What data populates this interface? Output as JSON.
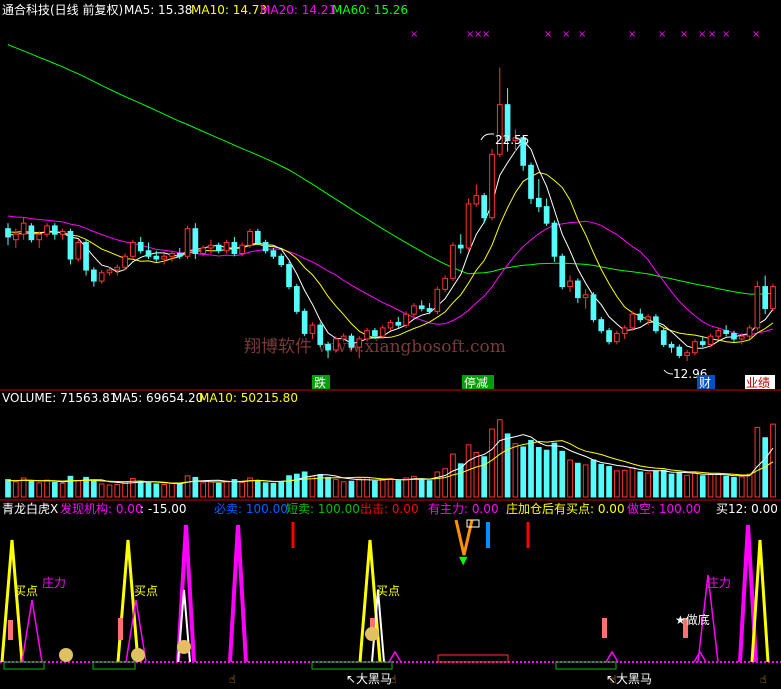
{
  "colors": {
    "background": "#000000",
    "candle_up": "#ff3232",
    "candle_down": "#54fcfc",
    "ma5": "#ffffff",
    "ma10": "#ffff00",
    "ma20": "#ff00ff",
    "ma60": "#00ff00",
    "divider": "#c80000",
    "text_default": "#ffffff",
    "label_green": "#00c000",
    "label_red": "#ff0000",
    "label_magenta": "#ff00ff",
    "label_yellow": "#ffff00"
  },
  "header": {
    "title": "通合科技(日线 前复权)",
    "ma5": "MA5: 15.38",
    "ma10": "MA10: 14.73",
    "ma20": "MA20: 14.21",
    "ma60": "MA60: 15.26"
  },
  "watermark": "翔博软件 www.xiangbosoft.com",
  "price_panel": {
    "high_label": "22.55",
    "low_label": "12.96",
    "markers": [
      {
        "text": "跌",
        "bg": "#00a000",
        "fg": "#ffffff"
      },
      {
        "text": "停减",
        "bg": "#00a000",
        "fg": "#ffffff"
      },
      {
        "text": "财",
        "bg": "#0050c0",
        "fg": "#ffffff"
      },
      {
        "text": "业绩",
        "bg": "#ffffff",
        "fg": "#c00000"
      }
    ]
  },
  "volume_panel": {
    "title": "VOLUME: 71563.81",
    "ma5": "MA5: 69654.20",
    "ma10": "MA10: 50215.80"
  },
  "indicator_panel": {
    "title": "青龙白虎X",
    "labels": [
      {
        "text": "发现机构: 0.00",
        "color": "#ff00ff"
      },
      {
        "text": ": -15.00",
        "color": "#ffffff"
      },
      {
        "text": "必卖: 100.00",
        "color": "#0060ff"
      },
      {
        "text": "短卖: 100.00",
        "color": "#00c000"
      },
      {
        "text": "出击: 0.00",
        "color": "#ff0000"
      },
      {
        "text": "有主力: 0.00",
        "color": "#ff00ff"
      },
      {
        "text": "庄加仓后有买点: 0.00",
        "color": "#ffff00"
      },
      {
        "text": "做空: 100.00",
        "color": "#ff00ff"
      },
      {
        "text": "买12: 0.00",
        "color": "#ffffff"
      }
    ],
    "annotations": [
      {
        "text": "买点",
        "color": "#ffff00"
      },
      {
        "text": "庄力",
        "color": "#ff00ff"
      },
      {
        "text": "买点",
        "color": "#ffff00"
      },
      {
        "text": "买点",
        "color": "#ffff00"
      },
      {
        "text": "庄力",
        "color": "#ff00ff"
      },
      {
        "text": "★做底",
        "color": "#ffffff"
      },
      {
        "text": "↖大黑马",
        "color": "#ffffff"
      },
      {
        "text": "↖大黑马",
        "color": "#ffffff"
      }
    ]
  },
  "chart_data": {
    "type": "candlestick",
    "price_range": [
      11.5,
      24.2
    ],
    "candles": [
      [
        16.7,
        16.9,
        16.1,
        16.4
      ],
      [
        16.3,
        16.7,
        16.0,
        16.5
      ],
      [
        16.5,
        17.1,
        16.3,
        16.9
      ],
      [
        16.8,
        16.9,
        16.2,
        16.3
      ],
      [
        16.3,
        16.6,
        16.0,
        16.5
      ],
      [
        16.5,
        16.9,
        16.4,
        16.8
      ],
      [
        16.8,
        16.9,
        16.3,
        16.5
      ],
      [
        16.5,
        16.7,
        16.3,
        16.6
      ],
      [
        16.6,
        16.7,
        15.4,
        15.6
      ],
      [
        15.6,
        16.3,
        15.5,
        16.2
      ],
      [
        16.2,
        16.3,
        15.0,
        15.2
      ],
      [
        15.2,
        15.3,
        14.6,
        14.8
      ],
      [
        14.8,
        15.2,
        14.7,
        15.1
      ],
      [
        15.1,
        15.3,
        15.0,
        15.2
      ],
      [
        15.2,
        15.4,
        15.0,
        15.3
      ],
      [
        15.3,
        15.8,
        15.2,
        15.7
      ],
      [
        15.7,
        16.3,
        15.6,
        16.2
      ],
      [
        16.2,
        16.4,
        15.8,
        15.9
      ],
      [
        15.9,
        16.2,
        15.6,
        15.7
      ],
      [
        15.7,
        15.9,
        15.5,
        15.6
      ],
      [
        15.6,
        15.8,
        15.4,
        15.7
      ],
      [
        15.7,
        15.9,
        15.5,
        15.8
      ],
      [
        15.8,
        16.0,
        15.6,
        15.7
      ],
      [
        15.7,
        16.8,
        15.6,
        16.7
      ],
      [
        16.7,
        16.9,
        15.6,
        15.8
      ],
      [
        15.8,
        16.1,
        15.7,
        16.0
      ],
      [
        16.0,
        16.3,
        15.8,
        16.1
      ],
      [
        16.1,
        16.2,
        15.8,
        15.9
      ],
      [
        15.9,
        16.3,
        15.8,
        16.2
      ],
      [
        16.2,
        16.4,
        15.7,
        15.8
      ],
      [
        15.8,
        16.2,
        15.7,
        16.1
      ],
      [
        16.1,
        16.7,
        16.0,
        16.6
      ],
      [
        16.6,
        16.7,
        16.1,
        16.2
      ],
      [
        16.2,
        16.3,
        15.8,
        15.9
      ],
      [
        15.9,
        16.0,
        15.6,
        15.7
      ],
      [
        15.7,
        15.8,
        15.3,
        15.4
      ],
      [
        15.4,
        15.5,
        14.5,
        14.6
      ],
      [
        14.6,
        14.7,
        13.6,
        13.7
      ],
      [
        13.7,
        13.8,
        12.8,
        12.9
      ],
      [
        12.9,
        13.3,
        12.7,
        13.2
      ],
      [
        13.2,
        13.3,
        12.4,
        12.5
      ],
      [
        12.5,
        12.6,
        12.0,
        12.3
      ],
      [
        12.3,
        12.8,
        12.2,
        12.7
      ],
      [
        12.7,
        12.9,
        12.6,
        12.8
      ],
      [
        12.8,
        12.9,
        12.3,
        12.4
      ],
      [
        12.4,
        12.8,
        12.0,
        12.7
      ],
      [
        12.7,
        13.1,
        12.6,
        13.0
      ],
      [
        13.0,
        13.1,
        12.7,
        12.8
      ],
      [
        12.8,
        13.2,
        12.7,
        13.1
      ],
      [
        13.1,
        13.4,
        13.0,
        13.3
      ],
      [
        13.3,
        13.5,
        13.1,
        13.2
      ],
      [
        13.2,
        13.7,
        13.1,
        13.6
      ],
      [
        13.6,
        14.0,
        13.5,
        13.9
      ],
      [
        13.9,
        14.1,
        13.7,
        13.8
      ],
      [
        13.8,
        14.0,
        13.6,
        13.7
      ],
      [
        13.7,
        14.6,
        13.6,
        14.5
      ],
      [
        14.5,
        15.0,
        14.4,
        14.9
      ],
      [
        14.9,
        16.2,
        14.8,
        16.1
      ],
      [
        16.1,
        16.5,
        15.8,
        16.0
      ],
      [
        16.0,
        17.8,
        15.9,
        17.6
      ],
      [
        17.6,
        18.3,
        17.5,
        17.9
      ],
      [
        17.9,
        18.0,
        16.9,
        17.1
      ],
      [
        17.1,
        19.6,
        17.0,
        19.4
      ],
      [
        19.4,
        22.55,
        19.3,
        21.2
      ],
      [
        21.2,
        21.8,
        19.5,
        19.9
      ],
      [
        19.9,
        20.3,
        19.5,
        20.0
      ],
      [
        20.0,
        20.1,
        18.8,
        19.0
      ],
      [
        19.0,
        19.1,
        17.6,
        17.8
      ],
      [
        17.8,
        18.5,
        17.3,
        17.5
      ],
      [
        17.5,
        17.8,
        16.8,
        16.9
      ],
      [
        16.9,
        17.0,
        15.5,
        15.7
      ],
      [
        15.7,
        15.8,
        14.5,
        14.6
      ],
      [
        14.6,
        15.0,
        14.4,
        14.8
      ],
      [
        14.8,
        14.9,
        14.0,
        14.2
      ],
      [
        14.2,
        14.5,
        13.8,
        14.3
      ],
      [
        14.3,
        14.4,
        13.3,
        13.4
      ],
      [
        13.4,
        13.5,
        12.9,
        13.0
      ],
      [
        13.0,
        13.1,
        12.5,
        12.6
      ],
      [
        12.6,
        13.0,
        12.5,
        12.9
      ],
      [
        12.9,
        13.2,
        12.7,
        13.1
      ],
      [
        13.1,
        13.7,
        13.0,
        13.6
      ],
      [
        13.6,
        13.8,
        13.3,
        13.4
      ],
      [
        13.4,
        13.6,
        13.2,
        13.5
      ],
      [
        13.5,
        13.6,
        12.9,
        13.0
      ],
      [
        13.0,
        13.1,
        12.4,
        12.5
      ],
      [
        12.5,
        12.6,
        12.2,
        12.4
      ],
      [
        12.4,
        12.5,
        12.0,
        12.1
      ],
      [
        12.1,
        12.3,
        11.9,
        12.2
      ],
      [
        12.2,
        12.7,
        12.1,
        12.6
      ],
      [
        12.6,
        12.8,
        12.4,
        12.5
      ],
      [
        12.5,
        12.9,
        12.4,
        12.8
      ],
      [
        12.8,
        13.1,
        12.7,
        13.0
      ],
      [
        13.0,
        13.2,
        12.8,
        12.9
      ],
      [
        12.9,
        13.0,
        12.6,
        12.7
      ],
      [
        12.7,
        12.9,
        12.5,
        12.8
      ],
      [
        12.8,
        13.2,
        12.7,
        13.1
      ],
      [
        13.1,
        14.8,
        13.0,
        14.6
      ],
      [
        14.6,
        15.0,
        13.6,
        13.8
      ],
      [
        13.8,
        14.7,
        13.7,
        14.6
      ]
    ],
    "volume": [
      3.2,
      2.8,
      3.5,
      2.9,
      2.6,
      3.1,
      2.7,
      2.5,
      3.8,
      3.0,
      3.6,
      2.9,
      2.4,
      2.2,
      2.3,
      2.8,
      3.4,
      2.9,
      2.6,
      2.4,
      2.3,
      2.5,
      2.4,
      3.9,
      3.6,
      2.6,
      2.8,
      2.5,
      2.9,
      3.2,
      2.7,
      3.5,
      3.0,
      2.6,
      2.5,
      2.8,
      3.9,
      4.2,
      4.6,
      3.8,
      4.1,
      3.6,
      3.2,
      2.8,
      2.9,
      3.3,
      3.6,
      2.9,
      3.1,
      3.4,
      3.0,
      3.5,
      3.8,
      3.2,
      3.0,
      4.6,
      5.2,
      7.9,
      6.1,
      9.6,
      8.2,
      7.4,
      12.5,
      14.2,
      11.6,
      9.8,
      9.2,
      10.4,
      9.1,
      8.6,
      9.9,
      8.4,
      6.8,
      6.2,
      5.9,
      6.8,
      6.0,
      5.6,
      4.8,
      4.9,
      5.4,
      4.6,
      4.4,
      4.8,
      4.9,
      4.2,
      4.5,
      4.0,
      4.4,
      3.9,
      4.1,
      4.3,
      3.8,
      3.6,
      3.7,
      4.2,
      12.8,
      10.9,
      13.4
    ],
    "volume_range": [
      0,
      16
    ]
  }
}
